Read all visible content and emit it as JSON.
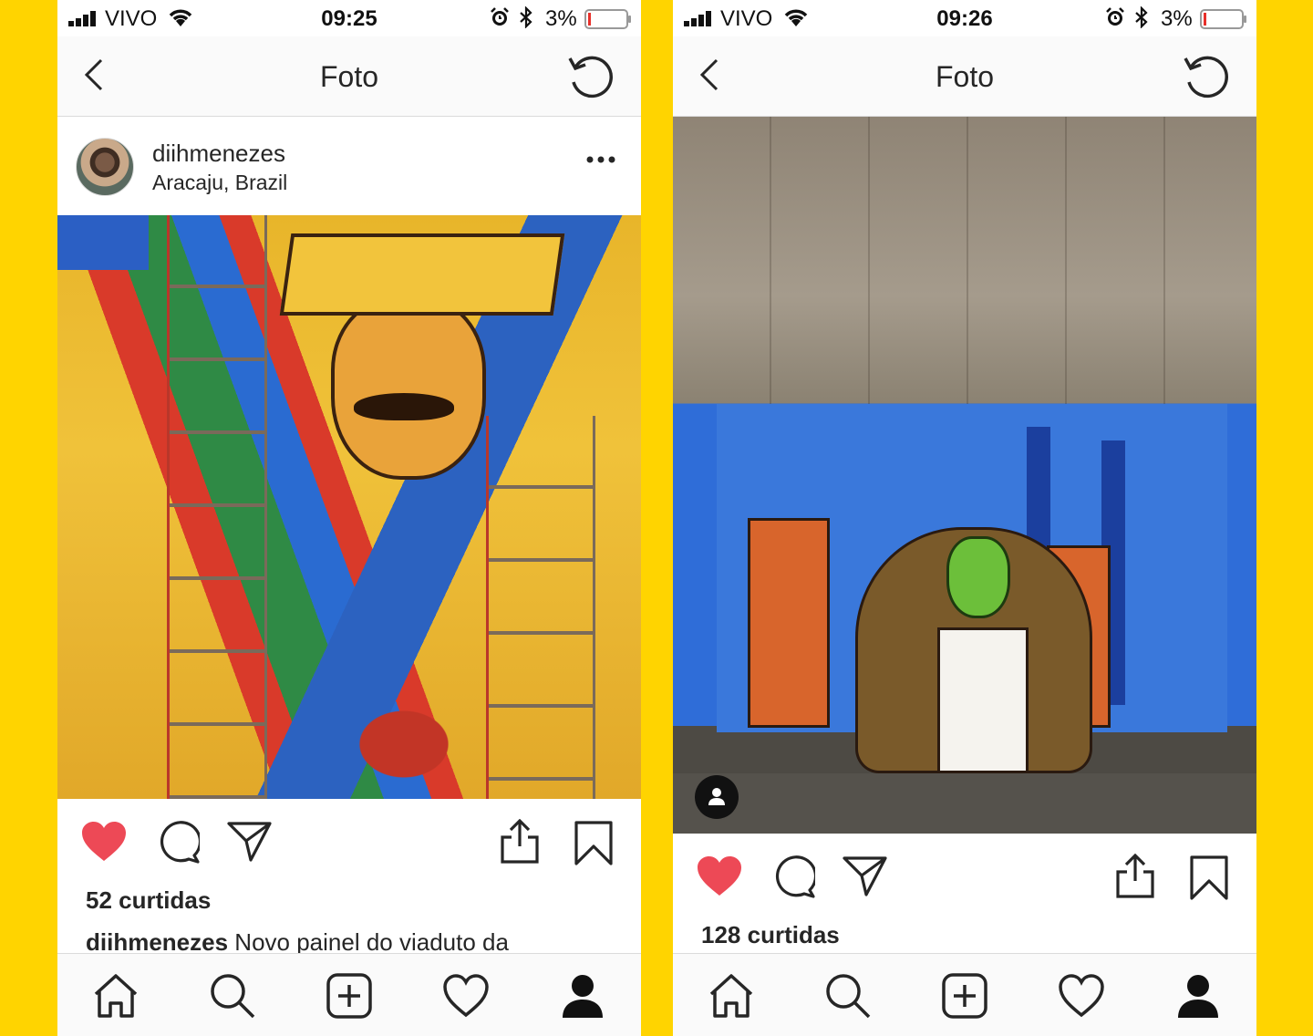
{
  "left_screen": {
    "status": {
      "carrier": "VIVO",
      "time": "09:25",
      "battery": "3%"
    },
    "nav": {
      "title": "Foto"
    },
    "post": {
      "username": "diihmenezes",
      "location": "Aracaju, Brazil",
      "likes": "52 curtidas",
      "caption_user": "diihmenezes",
      "caption_text": " Novo painel do viaduto da"
    }
  },
  "right_screen": {
    "status": {
      "carrier": "VIVO",
      "time": "09:26",
      "battery": "3%"
    },
    "nav": {
      "title": "Foto"
    },
    "post": {
      "likes": "128 curtidas"
    }
  },
  "colors": {
    "like_red": "#ED4956",
    "background_yellow": "#FFD400",
    "battery_low": "#E8302A"
  },
  "icons": [
    "signal-icon",
    "wifi-icon",
    "alarm-icon",
    "bluetooth-icon",
    "battery-icon",
    "back-icon",
    "refresh-icon",
    "more-icon",
    "heart-icon",
    "comment-icon",
    "direct-icon",
    "upload-icon",
    "bookmark-icon",
    "home-icon",
    "search-icon",
    "add-icon",
    "activity-icon",
    "profile-icon",
    "user-tag-icon"
  ]
}
